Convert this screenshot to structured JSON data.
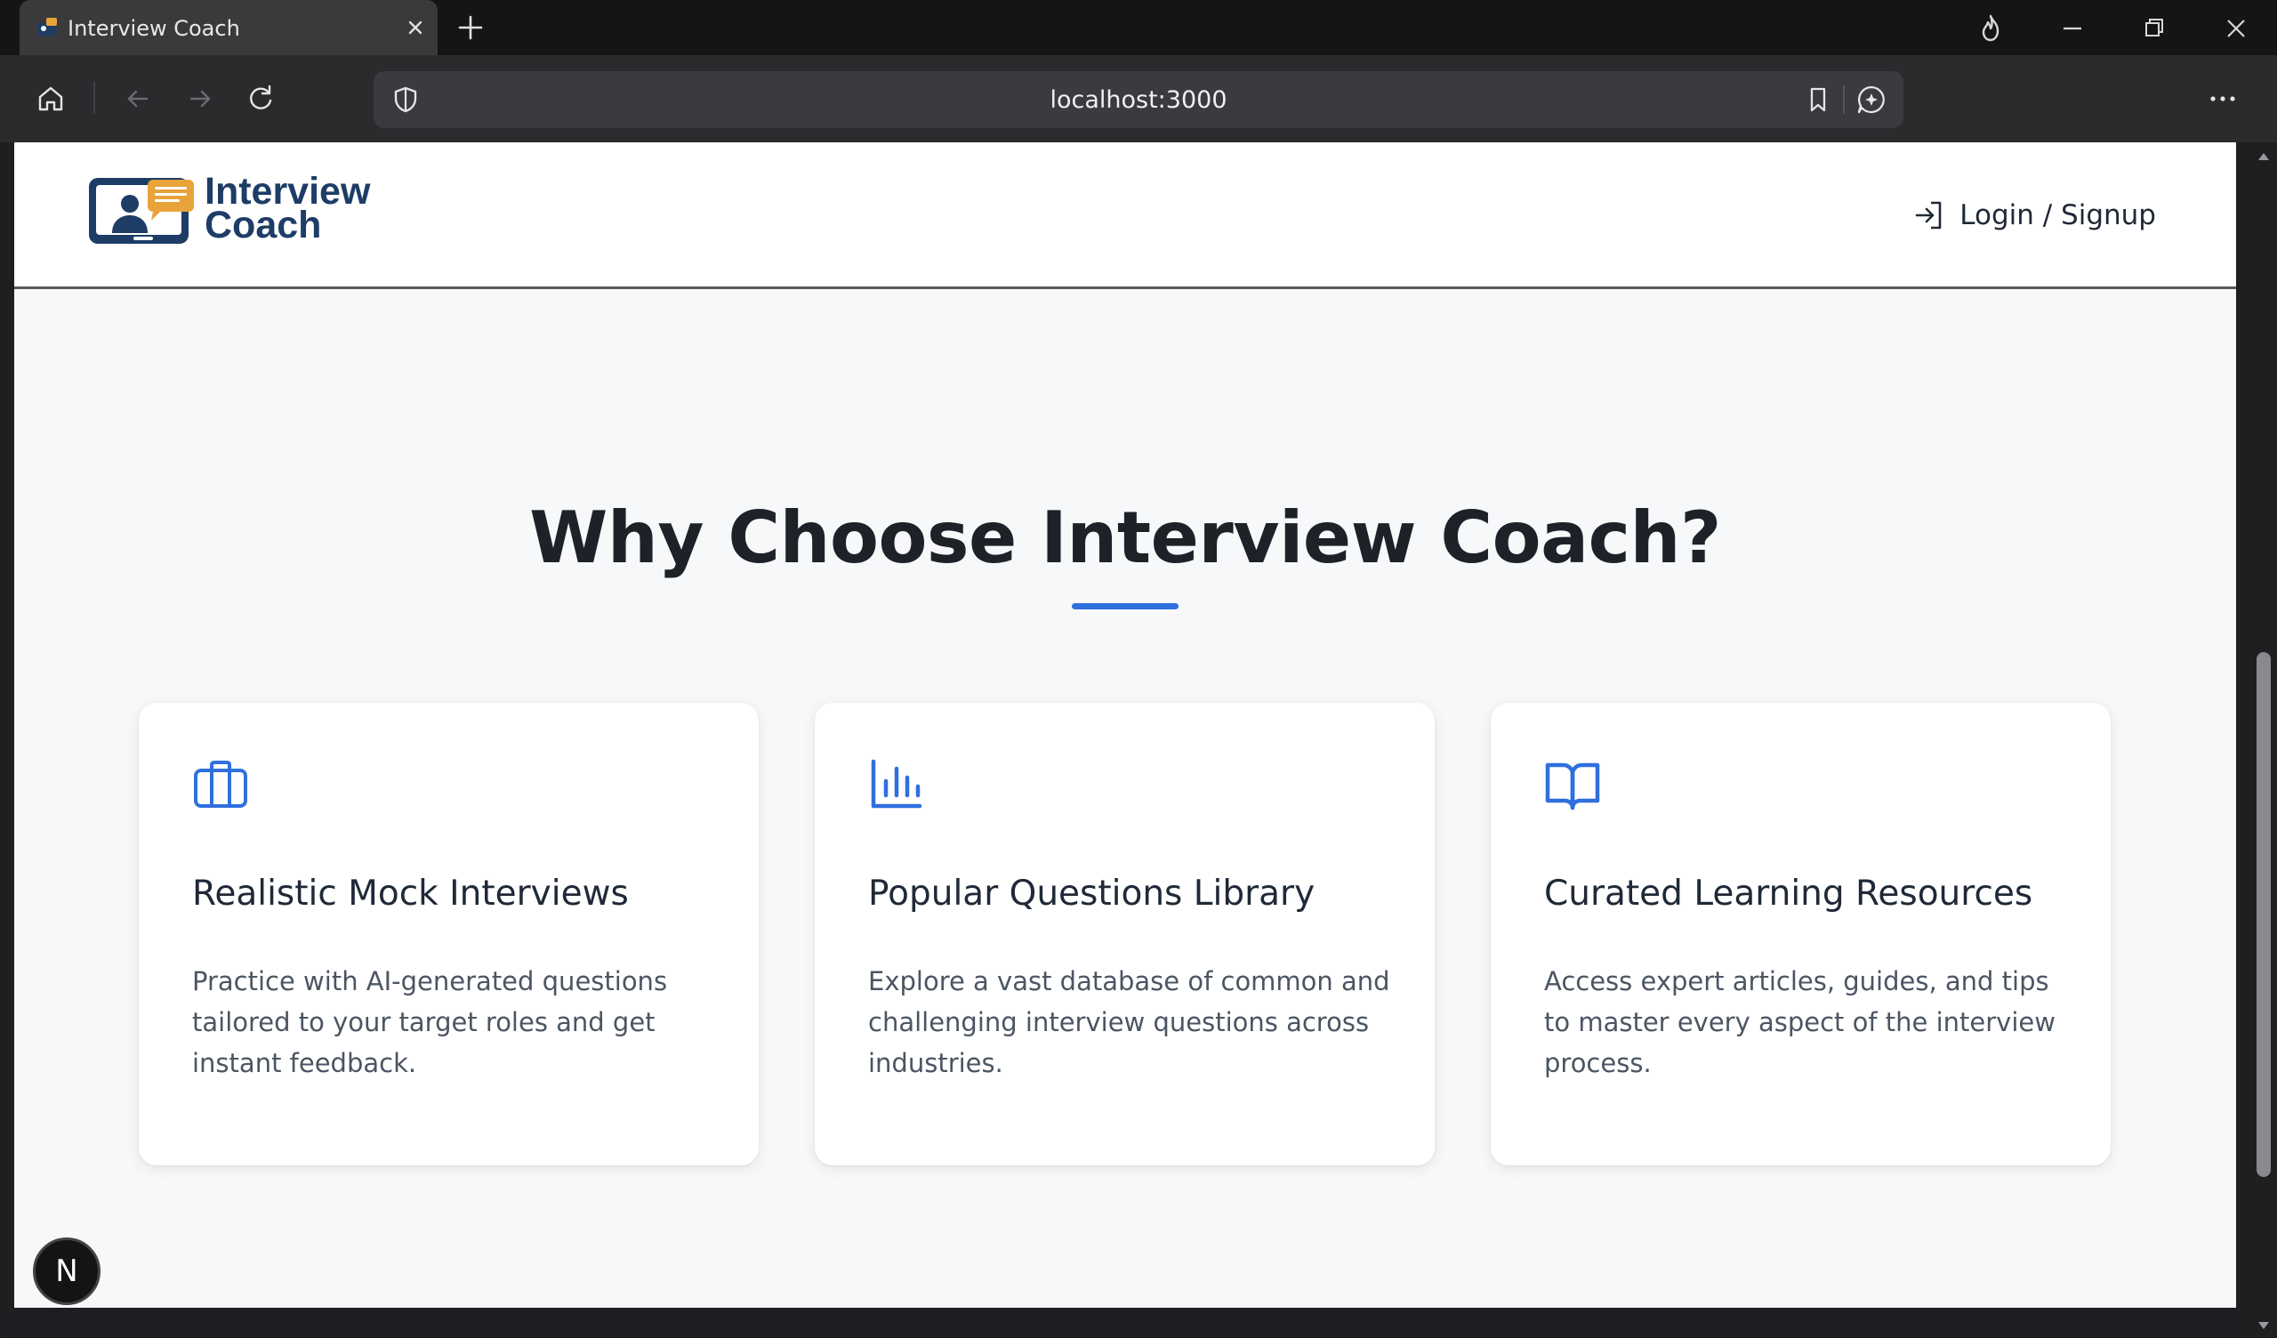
{
  "browser": {
    "tab_title": "Interview Coach",
    "url": "localhost:3000"
  },
  "header": {
    "logo_line1": "Interview",
    "logo_line2": "Coach",
    "login_label": "Login / Signup"
  },
  "features": {
    "title": "Why Choose Interview Coach?",
    "cards": [
      {
        "icon": "briefcase-icon",
        "title": "Realistic Mock Interviews",
        "description": "Practice with AI-generated questions tailored to your target roles and get instant feedback."
      },
      {
        "icon": "bar-chart-icon",
        "title": "Popular Questions Library",
        "description": "Explore a vast database of common and challenging interview questions across industries."
      },
      {
        "icon": "open-book-icon",
        "title": "Curated Learning Resources",
        "description": "Access expert articles, guides, and tips to master every aspect of the interview process."
      }
    ]
  },
  "dev_badge": {
    "label": "N"
  },
  "colors": {
    "accent": "#2f6fde",
    "brand_navy": "#1d3d66",
    "brand_orange": "#e8a33a"
  }
}
